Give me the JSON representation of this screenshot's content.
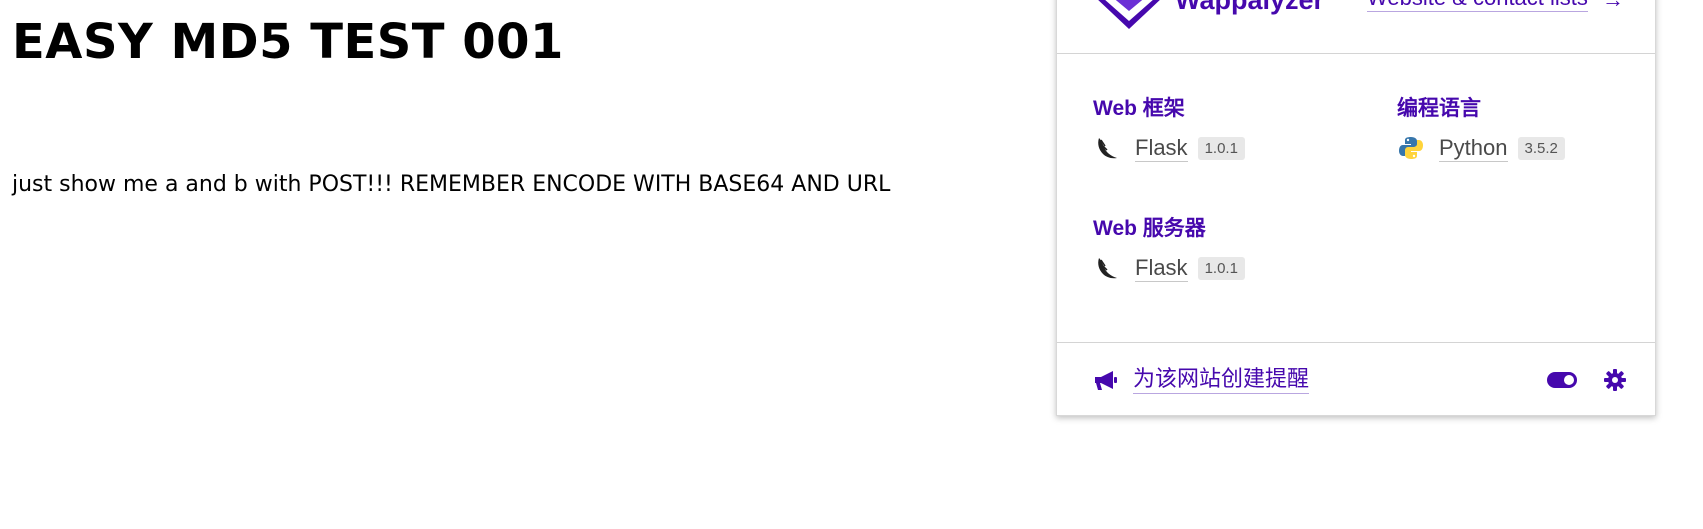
{
  "page": {
    "title": "EASY MD5 TEST 001",
    "text": "just show me a and b with POST!!! REMEMBER ENCODE WITH BASE64 AND URL"
  },
  "wappalyzer": {
    "brand": "Wappalyzer",
    "header_link": "Website & contact lists",
    "accent_color": "#4608ad",
    "categories": [
      {
        "title": "Web 框架",
        "tech": {
          "name": "Flask",
          "version": "1.0.1",
          "icon": "flask-icon"
        }
      },
      {
        "title": "编程语言",
        "tech": {
          "name": "Python",
          "version": "3.5.2",
          "icon": "python-icon"
        }
      },
      {
        "title": "Web 服务器",
        "tech": {
          "name": "Flask",
          "version": "1.0.1",
          "icon": "flask-icon"
        }
      }
    ],
    "footer": {
      "alert_label": "为该网站创建提醒",
      "toggle_state": "on"
    }
  }
}
